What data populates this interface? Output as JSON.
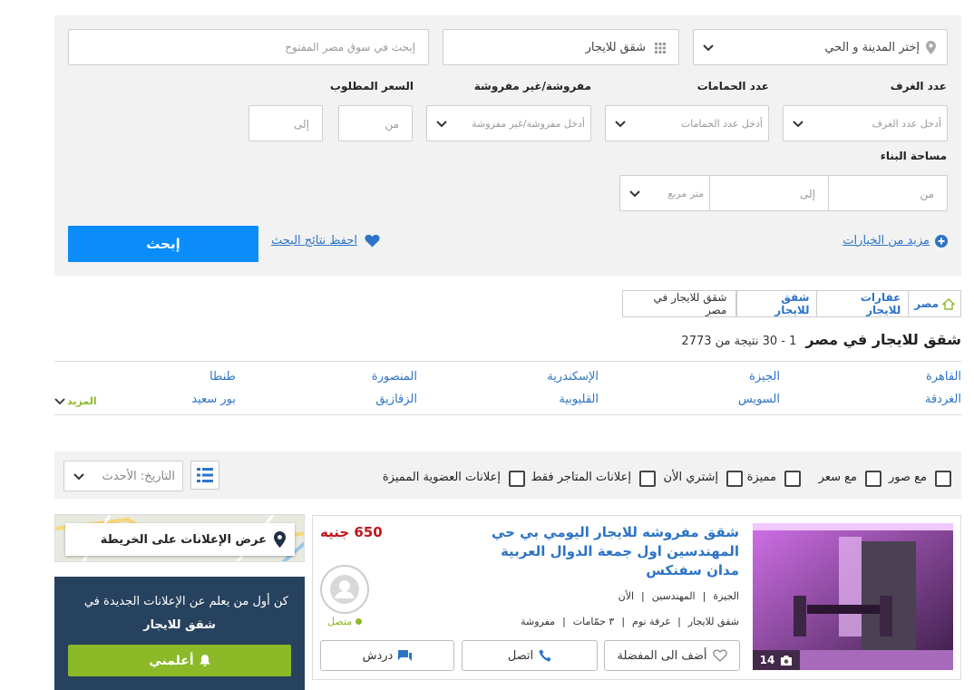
{
  "search": {
    "keyword_placeholder": "إبحث في سوق مصر المفتوح",
    "category_value": "شقق للايجار",
    "city_placeholder": "إختر المدينة و الحي",
    "rooms_label": "عدد الغرف",
    "rooms_placeholder": "أدخل عدد الغرف",
    "baths_label": "عدد الحمامات",
    "baths_placeholder": "أدخل عدد الحمامات",
    "furnished_label": "مفروشة/غير مفروشة",
    "furnished_placeholder": "أدخل مفروشة/غير مفروشة",
    "price_label": "السعر المطلوب",
    "price_from": "من",
    "price_to": "إلى",
    "area_label": "مساحة البناء",
    "area_from": "من",
    "area_to": "إلى",
    "area_unit": "متر مربع",
    "more_options": "مزيد من الخيارات",
    "save_results": "احفظ نتائج البحث",
    "search_button": "إبحث"
  },
  "breadcrumb": [
    "مصر",
    "عقارات للايجار",
    "شقق للايجار",
    "شقق للايجار في مصر"
  ],
  "results": {
    "title": "شقق للايجار في مصر",
    "count_text": "1 - 30 نتيجة من 2773"
  },
  "cities": {
    "row1": [
      "القاهرة",
      "الجيزة",
      "الإسكندرية",
      "المنصورة",
      "طنطا"
    ],
    "row2": [
      "الغردقة",
      "السويس",
      "القليوبية",
      "الزقازيق",
      "بور سعيد"
    ],
    "more": "المزيد"
  },
  "filters": {
    "with_photos": "مع صور",
    "with_price": "مع سعر",
    "featured": "مميزة",
    "buy_now": "إشتري الأن",
    "store_ads": "إعلانات المتاجر فقط",
    "premium_ads": "إعلانات العضوية المميزة",
    "sort_label": "التاريخ: الأحدث"
  },
  "map_box": {
    "label": "عرض الإعلانات على الخريطة"
  },
  "alert_box": {
    "line1": "كن أول من يعلم عن الإعلانات الجديدة في",
    "line2": "شقق للايجار",
    "button": "أعلمني"
  },
  "listing": {
    "title": "شقق مفروشه للايجار اليومي بي حي المهندسين اول جمعة الدوال العربية مدان سفنكس",
    "price": "650 جنيه",
    "location": [
      "الجيزة",
      "المهندسين",
      "الأن"
    ],
    "specs": [
      "شقق للايجار",
      "غرفة نوم",
      "٣ حمّامات",
      "مفروشة"
    ],
    "photo_count": "14",
    "seller_status": "متصل",
    "add_fav": "أضف الى المفضلة",
    "call": "اتصل",
    "chat": "دردش"
  },
  "colors": {
    "accent": "#0a8cfb",
    "link": "#2d73c7",
    "price": "#c0161c",
    "green": "#8bb928",
    "navy": "#27425e"
  }
}
